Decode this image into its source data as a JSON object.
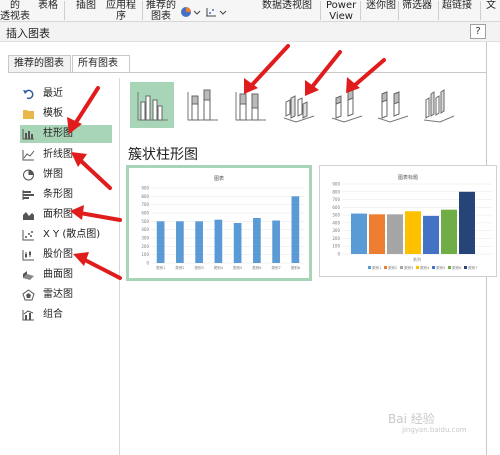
{
  "ribbon": {
    "items": [
      {
        "l1": "的",
        "l2": "透视表"
      },
      {
        "l1": "表格",
        "l2": ""
      },
      {
        "l1": "插图",
        "l2": ""
      },
      {
        "l1": "应用程",
        "l2": "序"
      },
      {
        "l1": "推荐的",
        "l2": "图表"
      },
      {
        "l1": "数据透视图",
        "l2": ""
      },
      {
        "l1": "Power",
        "l2": "View"
      },
      {
        "l1": "迷你图",
        "l2": ""
      },
      {
        "l1": "筛选器",
        "l2": ""
      },
      {
        "l1": "超链接",
        "l2": ""
      },
      {
        "l1": "文",
        "l2": ""
      }
    ]
  },
  "dialog": {
    "title": "插入图表",
    "help": "?",
    "tabs": [
      "推荐的图表",
      "所有图表"
    ],
    "categories": [
      "最近",
      "模板",
      "柱形图",
      "折线图",
      "饼图",
      "条形图",
      "面积图",
      "X Y (散点图)",
      "股价图",
      "曲面图",
      "雷达图",
      "组合"
    ],
    "selected_category": "柱形图",
    "section_title": "簇状柱形图",
    "preview1": {
      "title": "图表"
    },
    "preview2": {
      "title": "图表标题",
      "xlabel": "系列"
    }
  },
  "chart_data": [
    {
      "type": "bar",
      "title": "图表",
      "categories": [
        "类别1",
        "类别2",
        "类别3",
        "类别4",
        "类别5",
        "类别6",
        "类别7",
        "类别8"
      ],
      "values": [
        500,
        500,
        500,
        520,
        480,
        540,
        510,
        800
      ],
      "ylim": [
        0,
        900
      ],
      "yticks": [
        "0",
        "100",
        "200",
        "300",
        "400",
        "500",
        "600",
        "700",
        "800",
        "900"
      ]
    },
    {
      "type": "bar",
      "title": "图表标题",
      "xlabel": "系列",
      "categories": [
        "系列"
      ],
      "series": [
        {
          "name": "类别1",
          "values": [
            520
          ],
          "color": "#5b9bd5"
        },
        {
          "name": "类别2",
          "values": [
            510
          ],
          "color": "#ed7d31"
        },
        {
          "name": "类别3",
          "values": [
            510
          ],
          "color": "#a5a5a5"
        },
        {
          "name": "类别4",
          "values": [
            550
          ],
          "color": "#ffc000"
        },
        {
          "name": "类别5",
          "values": [
            490
          ],
          "color": "#4472c4"
        },
        {
          "name": "类别6",
          "values": [
            570
          ],
          "color": "#70ad47"
        },
        {
          "name": "类别7",
          "values": [
            800
          ],
          "color": "#264478"
        }
      ],
      "ylim": [
        0,
        900
      ],
      "yticks": [
        "0",
        "100",
        "200",
        "300",
        "400",
        "500",
        "600",
        "700",
        "800",
        "900"
      ]
    }
  ],
  "colors": {
    "selection": "#a8d4b8",
    "bar_blue": "#5b9bd5",
    "arrow_red": "#e01c1c"
  },
  "watermark": {
    "line1": "Bai 经验",
    "line2": "jingyan.baidu.com"
  }
}
